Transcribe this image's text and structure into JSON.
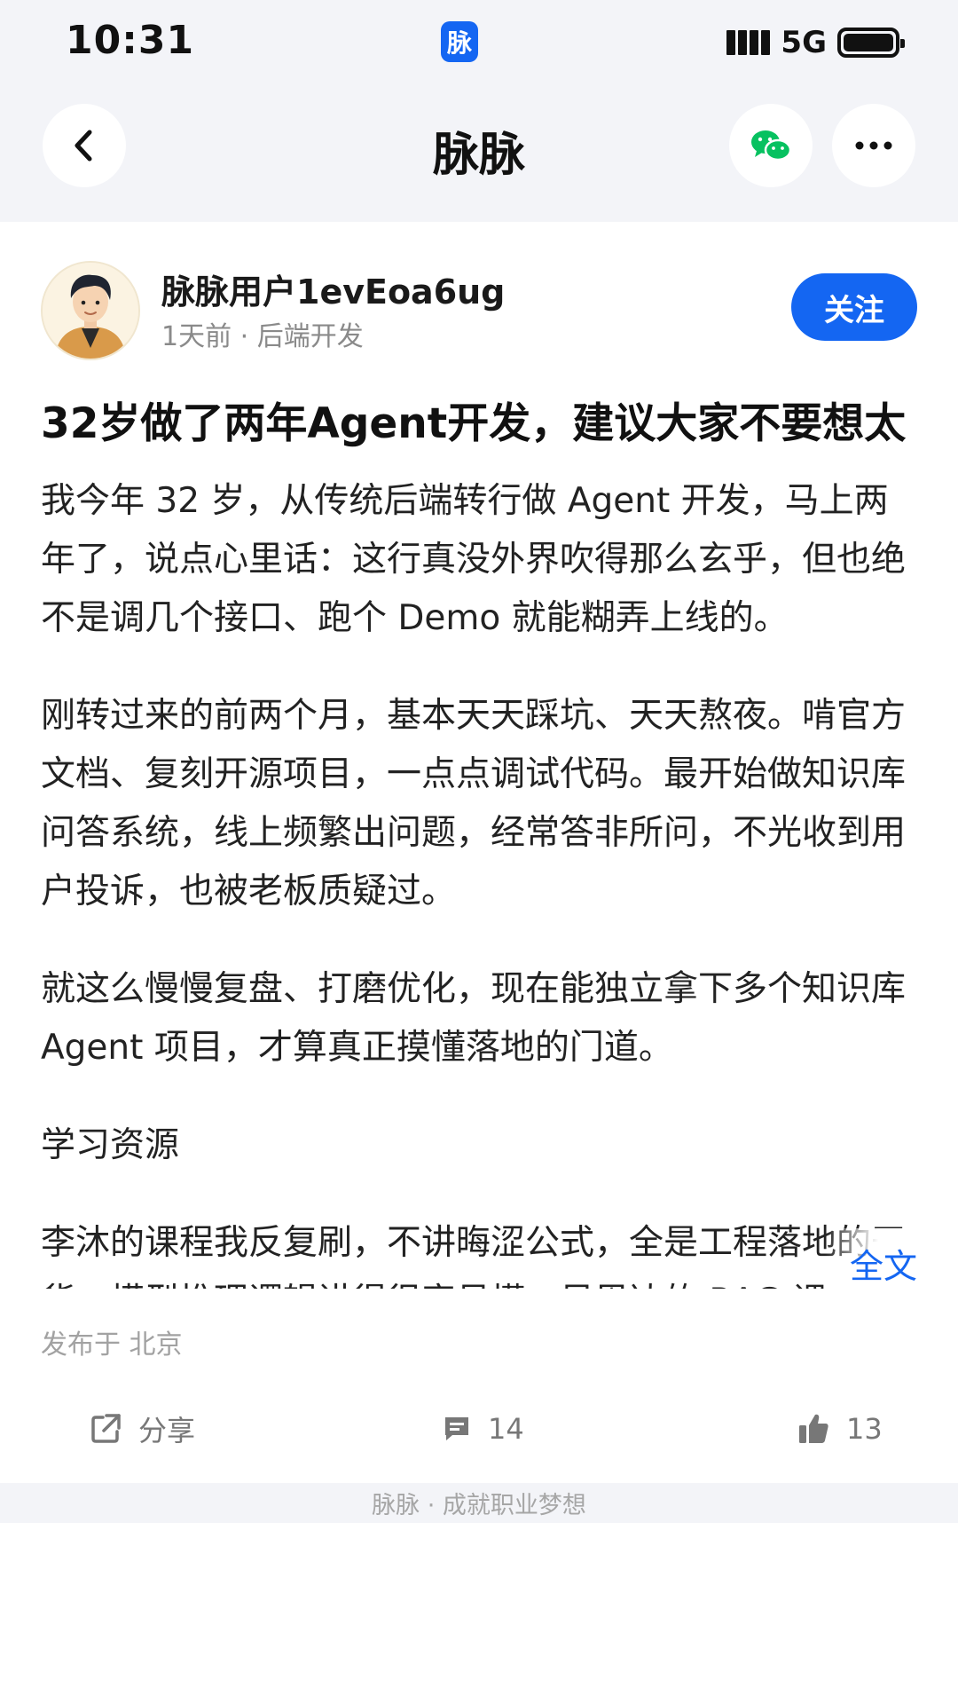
{
  "status_bar": {
    "time": "10:31",
    "app_badge": "脉",
    "network": "5G"
  },
  "nav": {
    "title": "脉脉",
    "back_icon": "chevron-left-icon",
    "share_icon": "wechat-icon",
    "more_icon": "more-horizontal-icon"
  },
  "author": {
    "name": "脉脉用户1evEoa6ug",
    "meta": "1天前 · 后端开发",
    "follow_label": "关注"
  },
  "post": {
    "title": "32岁做了两年Agent开发，建议大家不要想太",
    "paragraphs": [
      "我今年 32 岁，从传统后端转行做 Agent 开发，马上两年了，说点心里话：这行真没外界吹得那么玄乎，但也绝不是调几个接口、跑个 Demo 就能糊弄上线的。",
      "刚转过来的前两个月，基本天天踩坑、天天熬夜。啃官方文档、复刻开源项目，一点点调试代码。最开始做知识库问答系统，线上频繁出问题，经常答非所问，不光收到用户投诉，也被老板质疑过。",
      "就这么慢慢复盘、打磨优化，现在能独立拿下多个知识库 Agent 项目，才算真正摸懂落地的门道。",
      "学习资源",
      "李沐的课程我反复刷，不讲晦涩公式，全是工程落地的干货，模型推理逻辑讲得很容易懂。吴恩达的 RAG 课"
    ],
    "full_text_label": "全文",
    "location": "发布于 北京"
  },
  "actions": {
    "share_label": "分享",
    "comment_count": "14",
    "like_count": "13"
  },
  "footer": {
    "tagline": "脉脉 · 成就职业梦想"
  },
  "colors": {
    "accent": "#1466f2",
    "header_bg": "#f3f4f8",
    "wechat_green": "#07c160"
  }
}
